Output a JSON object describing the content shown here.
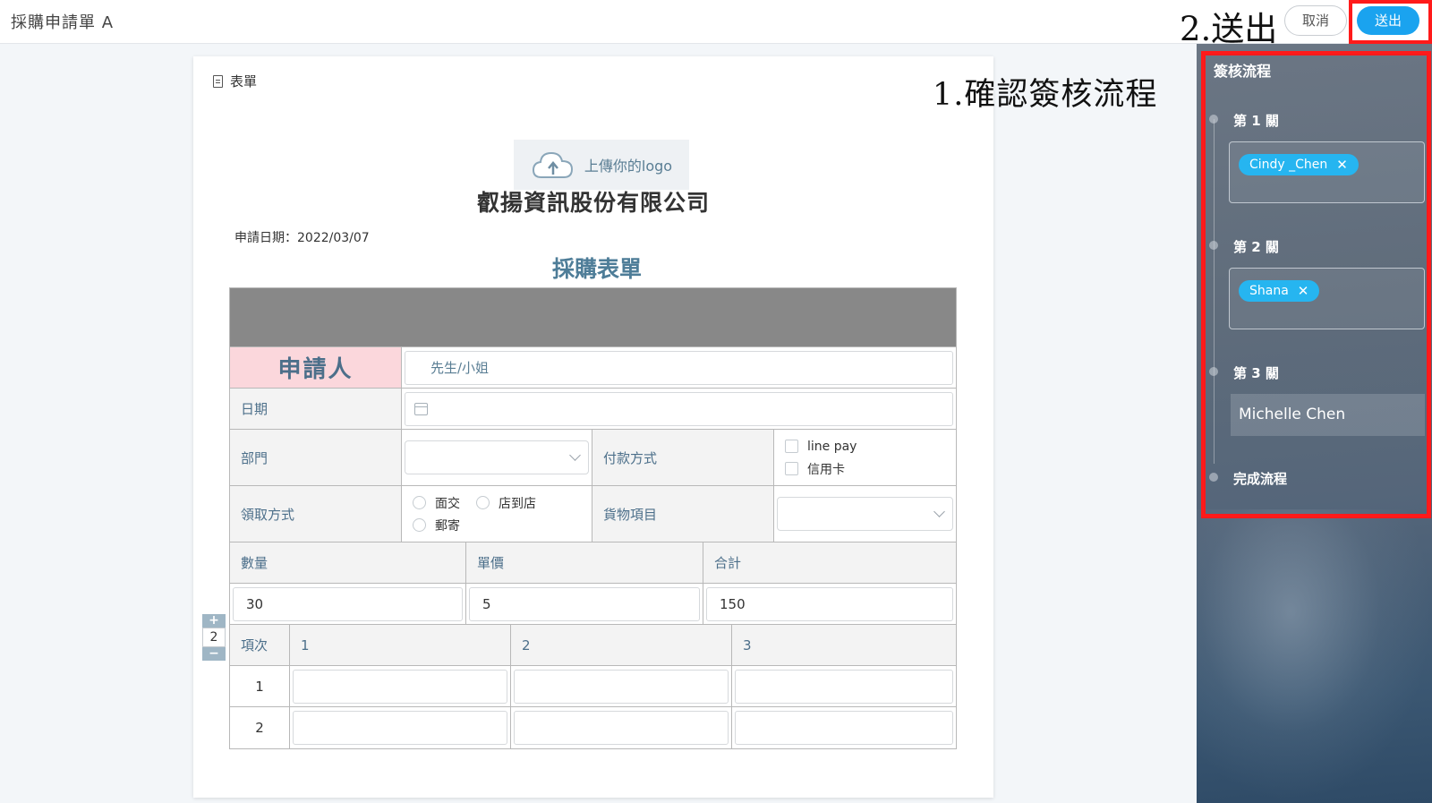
{
  "header": {
    "title": "採購申請單 A",
    "step2_note": "2.送出",
    "cancel_label": "取消",
    "send_label": "送出"
  },
  "form": {
    "tab_label": "表單",
    "step1_note": "1.確認簽核流程",
    "logo_upload": "上傳你的logo",
    "company": "叡揚資訊股份有限公司",
    "apply_date": "申請日期：2022/03/07",
    "title": "採購表單",
    "applicant_label": "申請人",
    "applicant_placeholder": "先生/小姐",
    "date_label": "日期",
    "dept_label": "部門",
    "payment_label": "付款方式",
    "payment_options": [
      "line pay",
      "信用卡"
    ],
    "pickup_label": "領取方式",
    "pickup_options": [
      "面交",
      "店到店",
      "郵寄"
    ],
    "goods_label": "貨物項目",
    "qty_label": "數量",
    "price_label": "單價",
    "total_label": "合計",
    "qty_value": "30",
    "price_value": "5",
    "total_value": "150",
    "item_label": "項次",
    "item_columns": [
      "1",
      "2",
      "3"
    ],
    "item_rows": [
      "1",
      "2"
    ],
    "stepper": {
      "plus": "+",
      "value": "2",
      "minus": "−"
    }
  },
  "flow": {
    "title": "簽核流程",
    "stages": [
      {
        "label": "第 1 關",
        "approver": "Cindy _Chen"
      },
      {
        "label": "第 2 關",
        "approver": "Shana"
      },
      {
        "label": "第 3 關",
        "approver": "Michelle Chen"
      }
    ],
    "done_label": "完成流程",
    "chip_remove": "✕"
  },
  "colors": {
    "accent": "#1aa3ef",
    "chip": "#26b5f0",
    "highlight_frame": "#ff1a1a",
    "applicant_bg": "#fbd7dc",
    "label_text": "#4c6f8a"
  }
}
